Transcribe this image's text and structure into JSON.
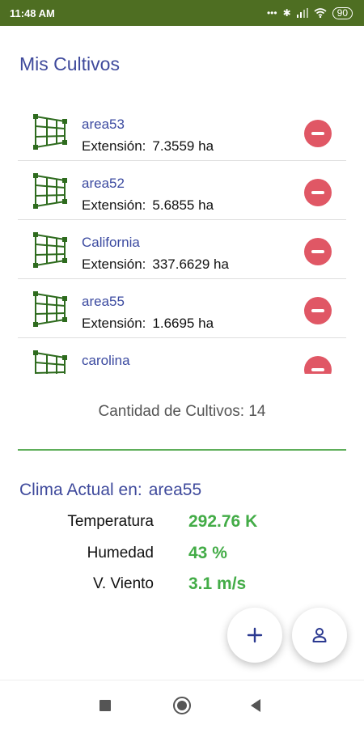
{
  "status_bar": {
    "time": "11:48 AM",
    "battery": "90",
    "icons": [
      "dots-icon",
      "bluetooth-icon",
      "signal-icon",
      "wifi-icon",
      "battery-icon"
    ]
  },
  "page_title": "Mis Cultivos",
  "crops": {
    "extension_label": "Extensión:",
    "items": [
      {
        "name": "area53",
        "extension": "7.3559 ha"
      },
      {
        "name": "area52",
        "extension": "5.6855 ha"
      },
      {
        "name": "California",
        "extension": "337.6629 ha"
      },
      {
        "name": "area55",
        "extension": "1.6695 ha"
      },
      {
        "name": "carolina",
        "extension": ""
      }
    ]
  },
  "crop_count": "Cantidad de Cultivos: 14",
  "weather": {
    "title": "Clima Actual en:",
    "location": "area55",
    "rows": [
      {
        "label": "Temperatura",
        "value": "292.76 K"
      },
      {
        "label": "Humedad",
        "value": "43 %"
      },
      {
        "label": "V. Viento",
        "value": "3.1 m/s"
      }
    ]
  },
  "fabs": {
    "add_icon": "plus-icon",
    "profile_icon": "user-icon"
  },
  "colors": {
    "status_bar": "#4e6e22",
    "title": "#3f4a9c",
    "remove_button": "#e05765",
    "weather_value": "#43ac47",
    "divider": "#5eae5a",
    "crop_icon": "#2e6b1e"
  }
}
